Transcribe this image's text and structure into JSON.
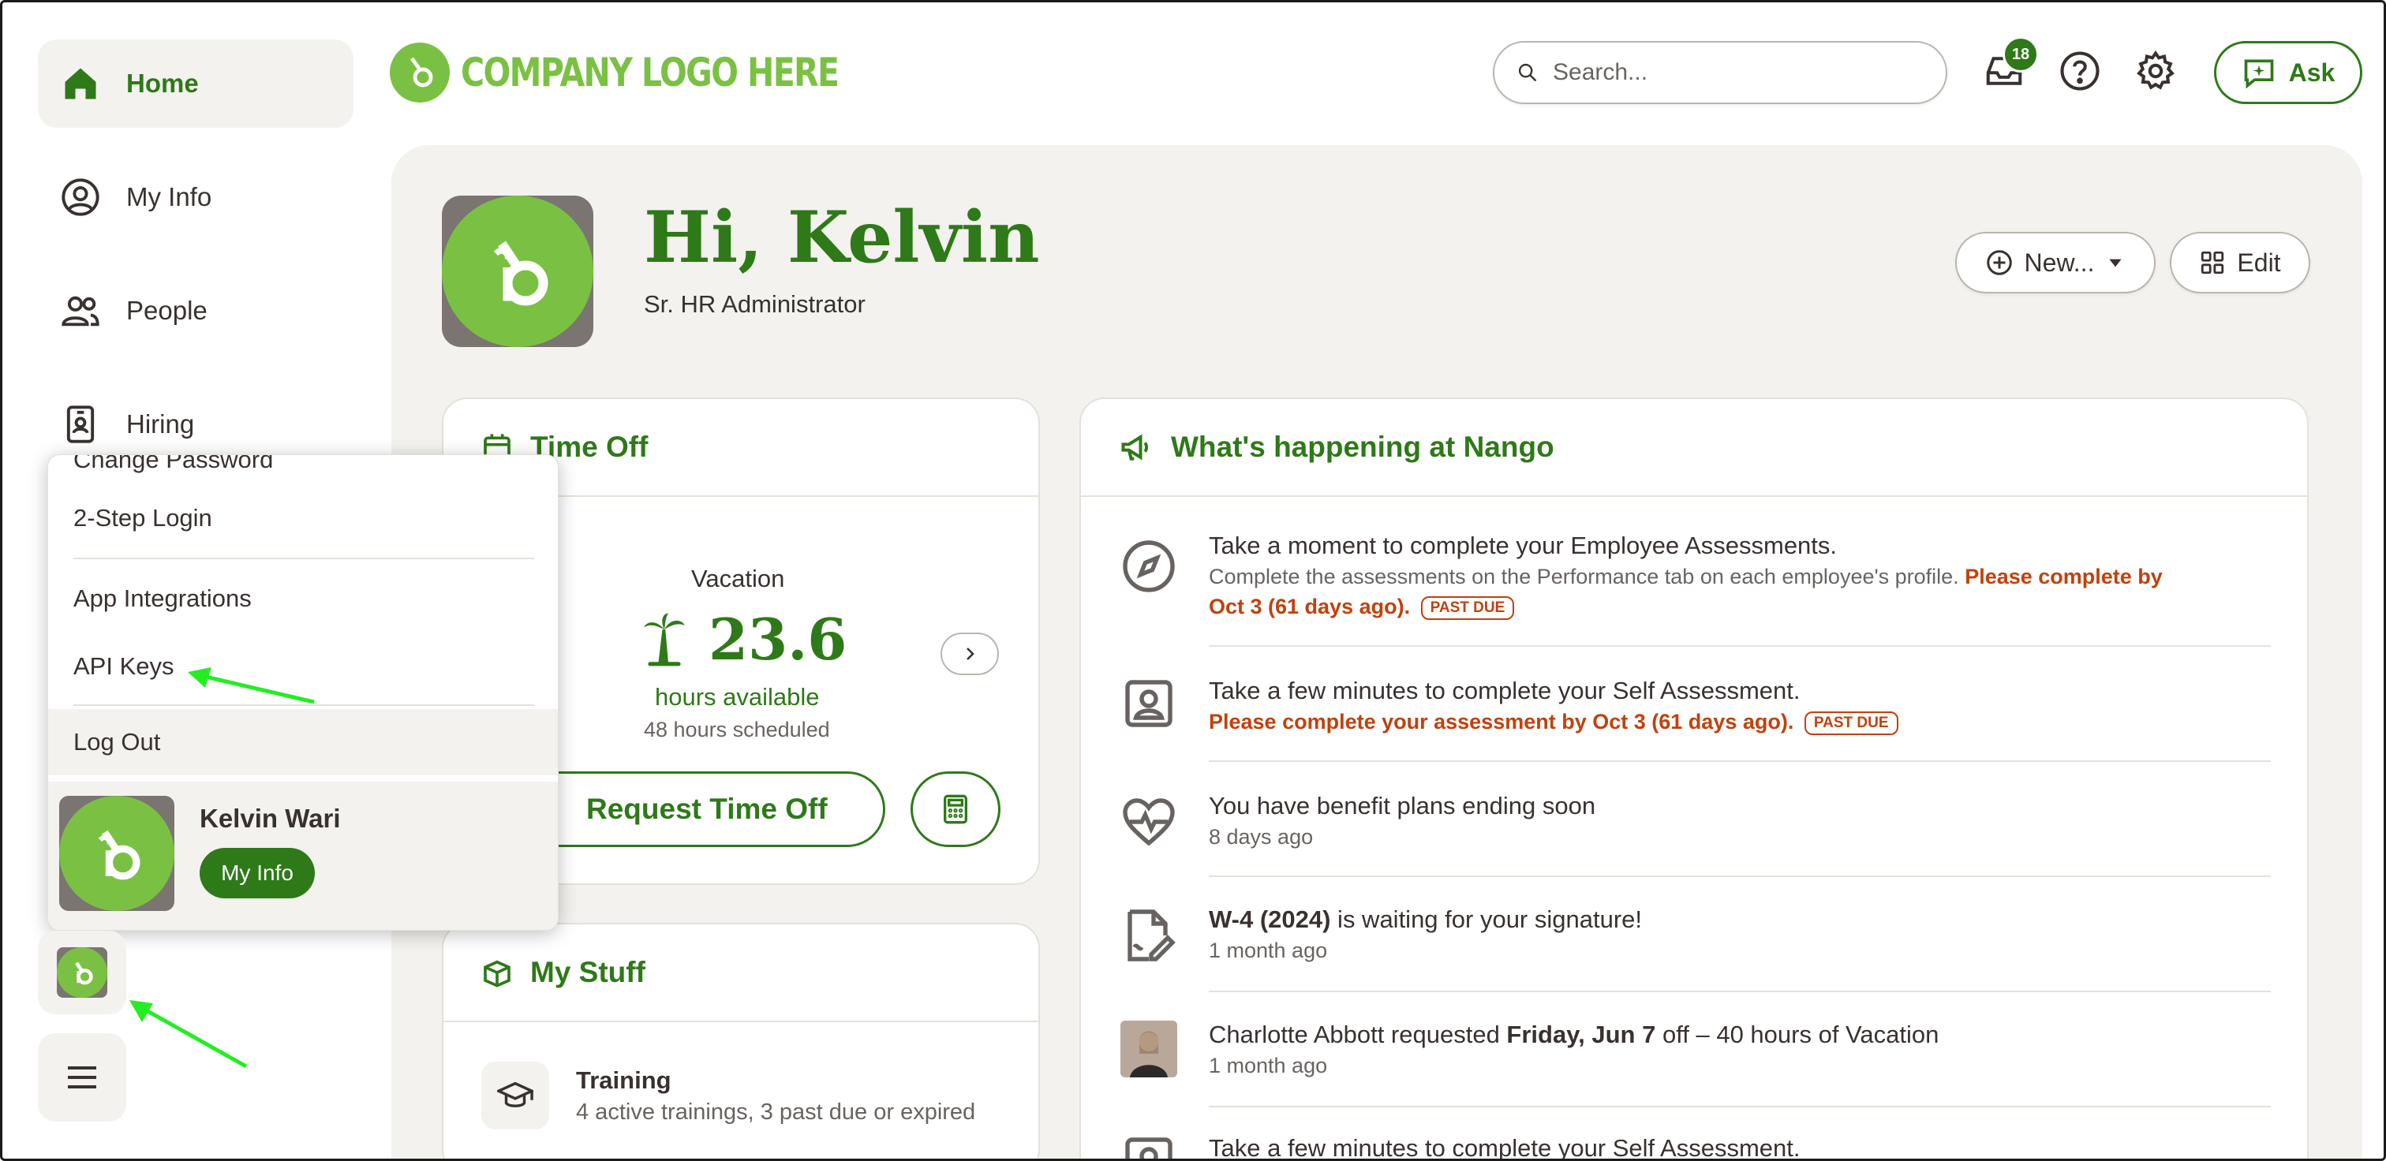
{
  "sidebar": {
    "items": [
      {
        "label": "Home",
        "icon": "home-icon"
      },
      {
        "label": "My Info",
        "icon": "user-circle-icon"
      },
      {
        "label": "People",
        "icon": "people-icon"
      },
      {
        "label": "Hiring",
        "icon": "badge-icon"
      }
    ]
  },
  "header": {
    "logo_text": "COMPANY LOGO HERE",
    "search_placeholder": "Search...",
    "inbox_count": "18",
    "ask_label": "Ask"
  },
  "profile": {
    "greeting": "Hi, Kelvin",
    "title": "Sr. HR Administrator",
    "new_label": "New...",
    "edit_label": "Edit"
  },
  "time_off": {
    "title": "Time Off",
    "type": "Vacation",
    "amount": "23.6",
    "available_label": "hours available",
    "scheduled": "48 hours scheduled",
    "request_label": "Request Time Off"
  },
  "my_stuff": {
    "title": "My Stuff",
    "items": [
      {
        "title": "Training",
        "subtitle": "4 active trainings, 3 past due or expired"
      }
    ]
  },
  "feed": {
    "title": "What's happening at Nango",
    "past_due_label": "PAST DUE",
    "items": [
      {
        "title": "Take a moment to complete your Employee Assessments.",
        "subtitle": "Complete the assessments on the Performance tab on each employee's profile.",
        "warning_part1": "Please complete by",
        "warning_part2": "Oct 3 (61 days ago)."
      },
      {
        "title": "Take a few minutes to complete your Self Assessment.",
        "warning": "Please complete your assessment by Oct 3 (61 days ago)."
      },
      {
        "title": "You have benefit plans ending soon",
        "subtitle": "8 days ago"
      },
      {
        "title_bold": "W-4 (2024)",
        "title_rest": " is waiting for your signature!",
        "subtitle": "1 month ago"
      },
      {
        "title_pre": "Charlotte Abbott requested ",
        "title_bold": "Friday, Jun 7",
        "title_post": " off – 40 hours of Vacation",
        "subtitle": "1 month ago"
      },
      {
        "title": "Take a few minutes to complete your Self Assessment."
      }
    ]
  },
  "menu": {
    "partial_item": "Change Password",
    "items": [
      "2-Step Login",
      "App Integrations",
      "API Keys"
    ],
    "logout": "Log Out",
    "user_name": "Kelvin Wari",
    "my_info_button": "My Info"
  },
  "colors": {
    "brand_green": "#2e7918",
    "logo_green": "#7ac143",
    "warning": "#c2410c",
    "annotation_arrow": "#22ee22"
  }
}
